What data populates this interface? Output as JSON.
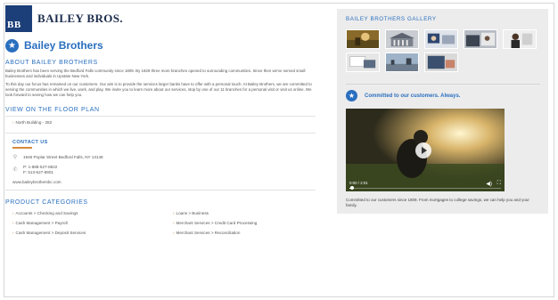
{
  "brand": {
    "logo_mark": "BB",
    "logo_text": "BAILEY BROS.",
    "logo_color": "#1d3f79"
  },
  "page": {
    "title": "Bailey Brothers",
    "title_icon": "star-icon",
    "accent_color": "#2a6fbf"
  },
  "about": {
    "heading": "ABOUT BAILEY BROTHERS",
    "paragraph_1": "Bailey Brothers has been serving the Bedford Falls community since 1809. By 1829 three more branches opened to surrounding communities. Since then we've served small businesses and individuals in Upstate New York.",
    "paragraph_2": "To this day our focus has remained on our customers. Our aim is to provide the services larger banks have to offer with a personal touch. At Bailey Brothers, we are committed to serving the communities in which we live, work, and play. We invite you to learn more about our services, stop by one of our 11 branches for a personal visit or visit us online. We look forward to seeing how we can help you."
  },
  "floor_plan": {
    "heading": "VIEW ON THE FLOOR PLAN",
    "link": "North Building - 282"
  },
  "contact": {
    "heading": "CONTACT US",
    "address": "1946 Poplar Street Bedford Falls, NY 13148",
    "phone_primary": "P: 1-888-527-8822",
    "phone_fax": "F: 513-527-8901",
    "website": "www.baileybrothersbc.com",
    "icons": [
      "location-pin-icon",
      "phone-icon"
    ]
  },
  "product_categories": {
    "heading": "PRODUCT CATEGORIES",
    "items": [
      "Accounts > Checking and Savings",
      "Loans > Business",
      "Cash Management > Payroll",
      "Merchant Services > Credit Card Processing",
      "Cash Management > Deposit Services",
      "Merchant Services > Reconciliation"
    ]
  },
  "gallery": {
    "heading": "BAILEY BROTHERS GALLERY",
    "thumbnails": [
      "photo-thumbnail-1",
      "photo-thumbnail-2",
      "photo-thumbnail-3",
      "photo-thumbnail-4",
      "photo-thumbnail-5",
      "photo-thumbnail-6",
      "photo-thumbnail-7",
      "photo-thumbnail-8"
    ]
  },
  "commitment": {
    "heading": "Committed to our customers. Always.",
    "video_time": "0:00 / 2:01",
    "video_progress": 0.02,
    "caption": "Committed to our customers since 1809. From mortgages to college savings, we can help you and your family."
  }
}
